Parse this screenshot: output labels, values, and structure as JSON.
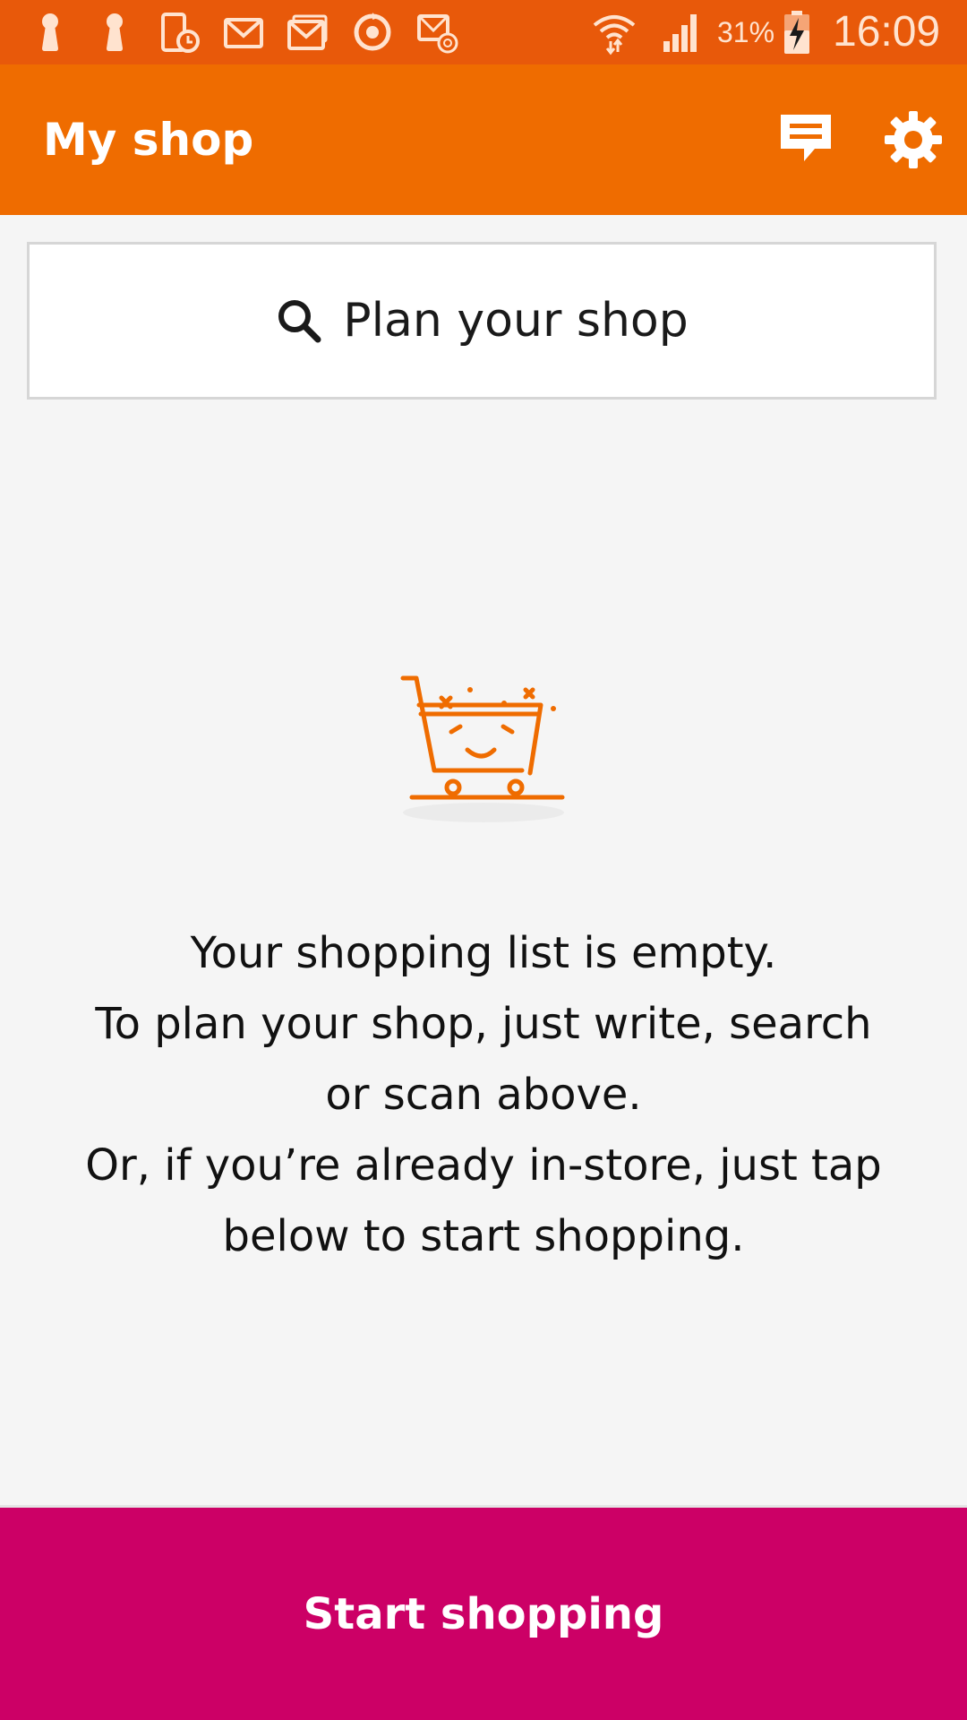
{
  "status_bar": {
    "battery_percent": "31%",
    "time": "16:09",
    "left_icons": [
      "keyhole-icon",
      "keyhole-icon",
      "phone-clock-icon",
      "gmail-icon",
      "gmail-stack-icon",
      "sync-icon",
      "email-at-icon"
    ],
    "right_icons": [
      "wifi-icon",
      "signal-icon",
      "battery-charging-icon"
    ]
  },
  "app_bar": {
    "title": "My shop",
    "actions": [
      "message-icon",
      "settings-icon"
    ]
  },
  "search": {
    "label": "Plan your shop"
  },
  "empty_state": {
    "illustration": "smiling-shopping-cart",
    "lines": [
      "Your shopping list is empty.",
      "To plan your shop, just write, search",
      "or scan above.",
      "Or, if you’re already in-store, just tap",
      "below to start shopping."
    ]
  },
  "start_button": {
    "label": "Start shopping"
  },
  "colors": {
    "status_bar": "#e8590a",
    "app_bar": "#ef6c00",
    "accent_orange": "#ef6c00",
    "start_button": "#cc0066",
    "background": "#f5f5f5"
  }
}
